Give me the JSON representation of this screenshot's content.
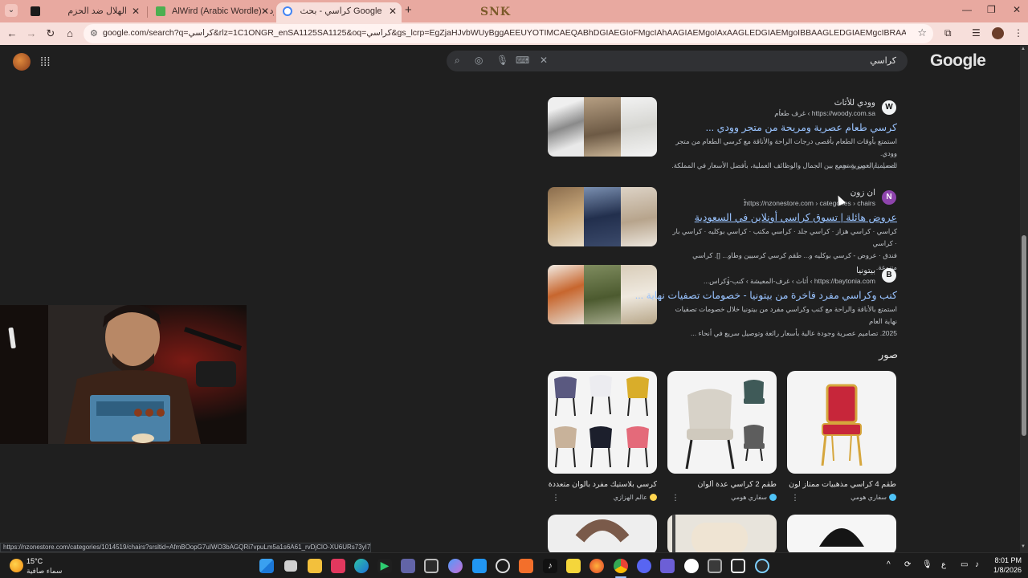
{
  "browser": {
    "tabs": [
      {
        "title": "الهلال ضد الحزم",
        "favicon_color": "#1a1a1a",
        "active": false
      },
      {
        "title": "AlWird (Arabic Wordle) - الورد",
        "favicon_color": "#4caf50",
        "active": false
      },
      {
        "title": "كراسي - بحث Google",
        "favicon_color": "#4285f4",
        "active": true
      }
    ],
    "new_tab_label": "+",
    "overlay_text": "SNK",
    "url": "google.com/search?q=كراسي&rlz=1C1ONGR_enSA1125SA1125&oq=كراسي&gs_lcrp=EgZjaHJvbWUyBggAEEUYOTIMCAEQABhDGIAEGIoFMgcIAhAAGIAEMgoIAxAAGLEDGIAEMgoIBBAAGLEDGIAEMgcIBRAAGIAEMgwIBhAAGEMYgAQYigUyBwgH..."
  },
  "google": {
    "logo": "Google",
    "query": "كراسي",
    "images_heading": "صور"
  },
  "results": [
    {
      "site_name": "وودي للأثاث",
      "site_icon": "W",
      "url": "https://woody.com.sa › غرف طعام",
      "title": "كرسي طعام عصرية ومريحة من متجر وودي ...",
      "snippet": [
        "استمتع بأوقات الطعام بأقصى درجات الراحة والأناقة مع كرسي الطعام من متجر وودي.",
        "تصميمنا العصرية تجمع بين الجمال والوظائف العملية، بأفضل الأسعار في المملكة."
      ],
      "extra": "التصاميم بدون رسوم",
      "visited": false
    },
    {
      "site_name": "ان زون",
      "site_icon": "N",
      "url": "https://nzonestore.com › categories › chairs",
      "title": "عروض هائلة | تسوق كراسي أونلاين في السعودية",
      "snippet": [
        "كراسي · كراسي هزاز · كراسي جلد · كراسي مكتب · كراسي بوكليه · كراسي بار · كراسي",
        "فندق · عروض - كرسي بوكليه و... طقم كرسي كرسيين وطاو... []. كراسي متنوعة."
      ],
      "extra": "",
      "visited": true
    },
    {
      "site_name": "بيتونيا",
      "site_icon": "B",
      "url": "https://baytonia.com › أثاث › غرف-المعيشة › كنب-وكراس...",
      "title": "كنب وكراسي مفرد فاخرة من بيتونيا - خصومات تصفيات نهاية ...",
      "snippet": [
        "استمتع بالأناقة والراحة مع كنب وكراسي مفرد من بيتونيا خلال خصومات تصفيات نهاية العام",
        "2025. تصاميم عصرية وجودة عالية بأسعار رائعة وتوصيل سريع في أنحاء ..."
      ],
      "extra": "",
      "visited": false
    }
  ],
  "images": [
    {
      "caption": "طقم 4 كراسي مذهبيات ممتاز لون احم...",
      "source": "سفاري هومي",
      "dot_color": "#4fc3f7"
    },
    {
      "caption": "طقم 2 كراسي عدة ألوان",
      "source": "سفاري هومي",
      "dot_color": "#4fc3f7"
    },
    {
      "caption": "كرسي بلاستيك مفرد بألوان متعددة ...",
      "source": "عالم الهزازي",
      "dot_color": "#ffd54f"
    }
  ],
  "status_url": "https://nzonestore.com/categories/1014519/chairs?srsltid=AfmBOopG7uIWO3bAGQRi7vpuLm5a1s6A61_rvDjClO-XU6URs73yI7X",
  "taskbar": {
    "weather_temp": "15°C",
    "weather_desc": "سماء صافية",
    "tray_lang": "ع",
    "time": "8:01 PM",
    "date": "1/8/2026"
  }
}
